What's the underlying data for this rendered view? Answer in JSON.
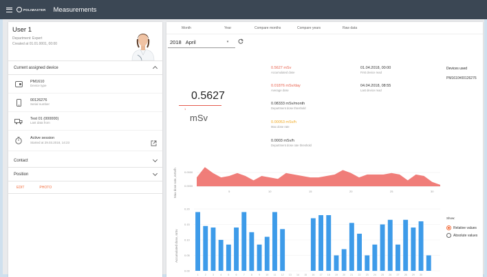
{
  "app": {
    "brand": "POLIMASTER",
    "title": "Measurements"
  },
  "user": {
    "name": "User 1",
    "department": "Department: Expert",
    "created": "Created at 01.01.0001, 00:00"
  },
  "device_section": {
    "title": "Current assigned device",
    "rows": [
      {
        "main": "PM1610",
        "sub": "Device type",
        "icon": "device-icon"
      },
      {
        "main": "00126276",
        "sub": "Serial number",
        "icon": "phone-icon"
      },
      {
        "main": "Test 01 (000000)",
        "sub": "Last data from",
        "icon": "sync-icon"
      },
      {
        "main": "Active session",
        "sub": "Started at 29.03.2018, 14:23",
        "icon": "timer-icon"
      }
    ]
  },
  "sections": {
    "contact": "Contact",
    "position": "Position"
  },
  "actions": {
    "edit": "EDIT",
    "photo": "PHOTO"
  },
  "tabs": [
    "Month",
    "Year",
    "Compare months",
    "Compare years",
    "Raw data"
  ],
  "period": {
    "year": "2018",
    "month": "April"
  },
  "summary": {
    "value": "0.5627",
    "tick": "1",
    "unit": "mSv"
  },
  "stats": {
    "accumulated": {
      "value": "0.5627 mSv",
      "label": "Accumulated dose"
    },
    "average": {
      "value": "0.01876 mSv/day",
      "label": "Average dose"
    },
    "dept_threshold": {
      "value": "0.08333 mSv/month",
      "label": "Department dose threshold"
    },
    "max_rate": {
      "value": "0.00053 mSv/h",
      "label": "Max dose rate"
    },
    "rate_threshold": {
      "value": "0.0003 mSv/h",
      "label": "Department dose rate threshold"
    },
    "first_read": {
      "value": "01.04.2018, 00:00",
      "label": "First device read"
    },
    "last_read": {
      "value": "04.04.2018, 08:55",
      "label": "Last device read"
    }
  },
  "devices_used": {
    "title": "Devices used",
    "value": "PM1610#00126276"
  },
  "show": {
    "title": "Show:",
    "relative": "Relative values",
    "absolute": "Absolute values"
  },
  "colors": {
    "accent": "#f26b3a",
    "area": "#ee6f6a",
    "bar": "#3d9be9",
    "topbar": "#3b4754"
  },
  "chart_data": [
    {
      "type": "area",
      "ylabel": "Max dose rate, mSv/h",
      "y_ticks": [
        "0.0000",
        "0.0000"
      ],
      "x_ticks": [
        "5",
        "10",
        "15",
        "20",
        "25",
        "30"
      ],
      "x": [
        1,
        2,
        3,
        4,
        5,
        6,
        7,
        8,
        9,
        10,
        11,
        12,
        13,
        14,
        15,
        16,
        17,
        18,
        19,
        20,
        21,
        22,
        23,
        24,
        25,
        26,
        27,
        28,
        29,
        30,
        31
      ],
      "values": [
        0.6,
        1.3,
        0.9,
        0.6,
        0.7,
        0.9,
        0.7,
        0.4,
        0.7,
        0.6,
        0.5,
        0.9,
        0.8,
        0.7,
        0.6,
        0.6,
        0.7,
        0.8,
        1.1,
        0.9,
        0.6,
        0.8,
        0.8,
        0.8,
        0.9,
        0.8,
        0.4,
        0.8,
        0.7,
        0.3,
        0.1
      ]
    },
    {
      "type": "bar",
      "ylabel": "Accumulated dose, mSv",
      "y_ticks": [
        "0.00",
        "0.05",
        "0.10",
        "0.15",
        "0.20"
      ],
      "ylim": [
        0,
        0.2
      ],
      "categories": [
        "1",
        "2",
        "3",
        "4",
        "5",
        "6",
        "7",
        "8",
        "9",
        "10",
        "11",
        "12",
        "13",
        "14",
        "15",
        "16",
        "17",
        "18",
        "19",
        "20",
        "21",
        "22",
        "23",
        "24",
        "25",
        "26",
        "27",
        "28",
        "29",
        "30"
      ],
      "values": [
        0.19,
        0.145,
        0.14,
        0.1,
        0.085,
        0.14,
        0.19,
        0.125,
        0.085,
        0.11,
        0.19,
        0.135,
        0.0,
        0.0,
        0.0,
        0.17,
        0.18,
        0.18,
        0.05,
        0.07,
        0.155,
        0.12,
        0.05,
        0.085,
        0.15,
        0.165,
        0.085,
        0.165,
        0.14,
        0.16,
        0.05,
        0.0
      ]
    }
  ]
}
